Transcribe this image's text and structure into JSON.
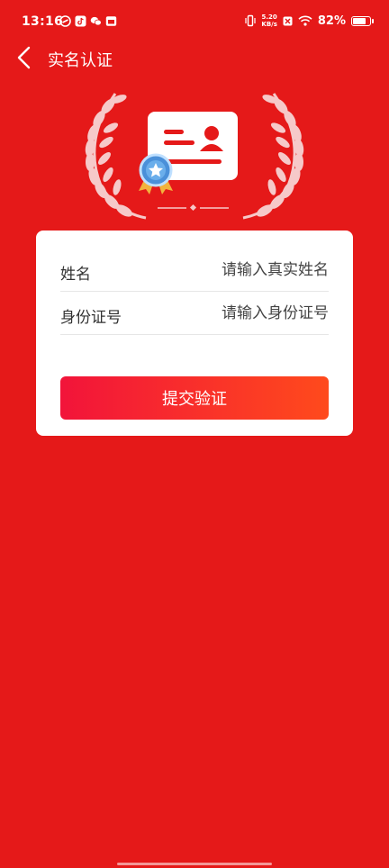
{
  "status_bar": {
    "time": "13:16",
    "net_speed_value": "5.20",
    "net_speed_unit": "KB/s",
    "battery": "82%"
  },
  "header": {
    "title": "实名认证"
  },
  "form": {
    "name_label": "姓名",
    "name_placeholder": "请输入真实姓名",
    "id_label": "身份证号",
    "id_placeholder": "请输入身份证号",
    "submit_label": "提交验证"
  },
  "colors": {
    "background": "#E51919",
    "card": "#FFFFFF",
    "button_start": "#F2143A",
    "button_end": "#FF4A1C"
  },
  "icons": [
    "back-arrow-icon",
    "id-card-icon",
    "badge-star-icon",
    "laurel-icon"
  ]
}
